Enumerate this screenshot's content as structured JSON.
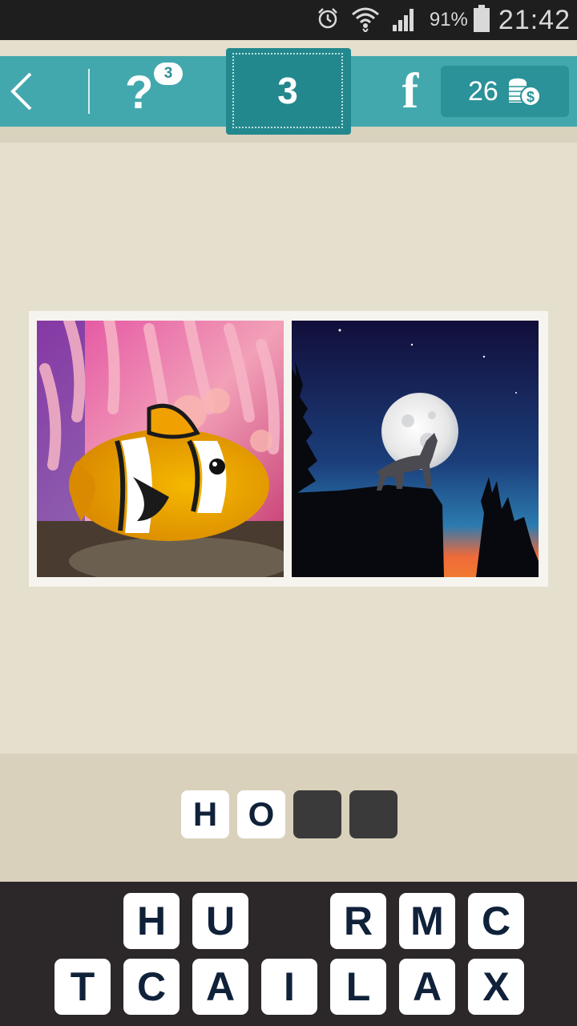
{
  "status_bar": {
    "battery_percent": "91%",
    "time": "21:42",
    "icons": [
      "alarm-icon",
      "wifi-icon",
      "signal-icon",
      "battery-icon"
    ]
  },
  "top_bar": {
    "back_icon": "chevron-left-icon",
    "help_label": "?",
    "help_badge": "3",
    "level": "3",
    "facebook_label": "f",
    "coins": "26",
    "coins_icon": "coin-stack-icon",
    "colors": {
      "bar": "#43a8ad",
      "level_tab": "#23888e",
      "coins_bg": "#2a9298"
    }
  },
  "images": [
    {
      "subject": "clownfish-photo"
    },
    {
      "subject": "wolf-howling-moon-photo"
    }
  ],
  "answer": {
    "slots": [
      "H",
      "O",
      "",
      ""
    ]
  },
  "keyboard": {
    "row1": [
      "H",
      "U",
      "",
      "R",
      "M",
      "C"
    ],
    "row2": [
      "T",
      "C",
      "A",
      "I",
      "L",
      "A",
      "X"
    ]
  }
}
